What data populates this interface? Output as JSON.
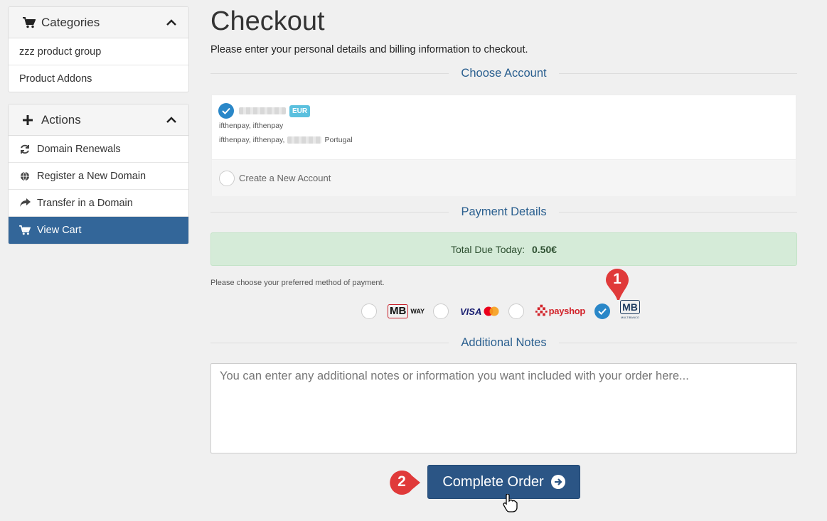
{
  "sidebar": {
    "categories": {
      "title": "Categories",
      "items": [
        {
          "label": "zzz product group"
        },
        {
          "label": "Product Addons"
        }
      ]
    },
    "actions": {
      "title": "Actions",
      "items": [
        {
          "label": "Domain Renewals",
          "icon": "refresh-icon"
        },
        {
          "label": "Register a New Domain",
          "icon": "globe-icon"
        },
        {
          "label": "Transfer in a Domain",
          "icon": "share-icon"
        },
        {
          "label": "View Cart",
          "icon": "cart-icon",
          "active": true
        }
      ]
    }
  },
  "main": {
    "title": "Checkout",
    "subtitle": "Please enter your personal details and billing information to checkout.",
    "choose_account": {
      "heading": "Choose Account",
      "account": {
        "currency": "EUR",
        "line1": "ifthenpay, ifthenpay",
        "line2_prefix": "ifthenpay, ifthenpay,",
        "line2_suffix": "Portugal"
      },
      "new_account_label": "Create a New Account"
    },
    "payment": {
      "heading": "Payment Details",
      "total_label": "Total Due Today:",
      "total_amount": "0.50€",
      "hint": "Please choose your preferred method of payment.",
      "methods": [
        {
          "name": "MB WAY",
          "text_mb": "MB",
          "text_way": "WAY",
          "selected": false
        },
        {
          "name": "Visa Mastercard",
          "text": "VISA",
          "selected": false
        },
        {
          "name": "payshop",
          "text": "payshop",
          "selected": false
        },
        {
          "name": "Multibanco",
          "text": "MB",
          "subtext": "MULTIBANCO",
          "selected": true
        }
      ]
    },
    "notes": {
      "heading": "Additional Notes",
      "placeholder": "You can enter any additional notes or information you want included with your order here..."
    },
    "complete_label": "Complete Order"
  },
  "annotations": {
    "marker1": "1",
    "marker2": "2",
    "marker_color": "#e03a3a"
  },
  "colors": {
    "primary": "#2b5585",
    "active_sidebar": "#336699",
    "heading_blue": "#2a5f8f",
    "success_bg": "#d5ebd8",
    "check_blue": "#2a87c8"
  }
}
